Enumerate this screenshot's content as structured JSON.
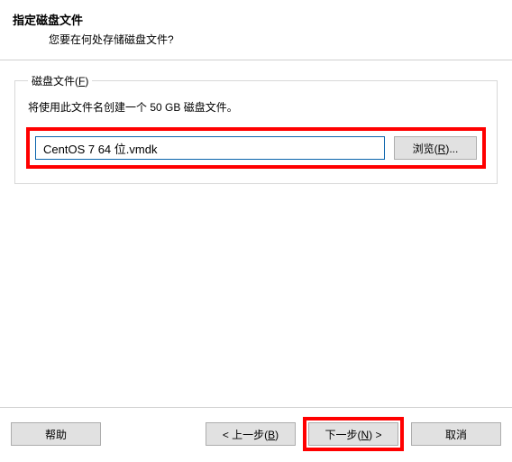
{
  "header": {
    "title": "指定磁盘文件",
    "subtitle": "您要在何处存储磁盘文件?"
  },
  "group": {
    "legend_prefix": "磁盘文件(",
    "legend_hotkey": "F",
    "legend_suffix": ")",
    "description": "将使用此文件名创建一个 50 GB 磁盘文件。",
    "filename_value": "CentOS 7 64 位.vmdk",
    "browse_prefix": "浏览(",
    "browse_hotkey": "R",
    "browse_suffix": ")..."
  },
  "footer": {
    "help": "帮助",
    "back_prefix": "< 上一步(",
    "back_hotkey": "B",
    "back_suffix": ")",
    "next_prefix": "下一步(",
    "next_hotkey": "N",
    "next_suffix": ") >",
    "cancel": "取消"
  }
}
